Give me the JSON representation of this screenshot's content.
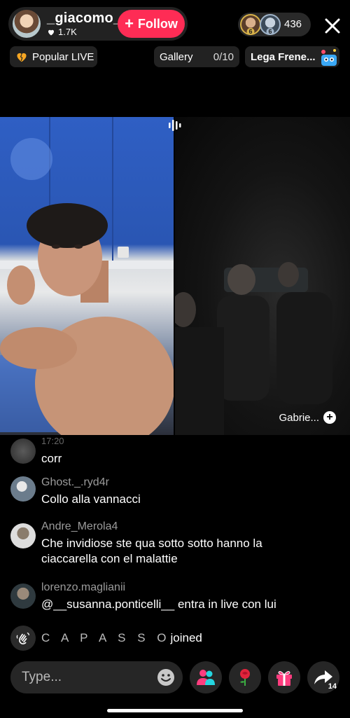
{
  "host": {
    "name": "_giacomo_",
    "likes": "1.7K",
    "follow_label": "Follow"
  },
  "viewers": {
    "badges": [
      "6",
      "6"
    ],
    "count": "436"
  },
  "pills": {
    "popular": "Popular LIVE",
    "gallery": "Gallery",
    "gallery_count": "0/10",
    "lega": "Lega Frene..."
  },
  "video": {
    "guest_label": "Gabrie..."
  },
  "comments": [
    {
      "user": "17:20",
      "text": "corr"
    },
    {
      "user": "Ghost._.ryd4r",
      "text": "Collo alla vannacci"
    },
    {
      "user": "Andre_Merola4",
      "text": "Che invidiose ste qua sotto sotto hanno la ciaccarella con el malattie"
    },
    {
      "user": "lorenzo.maglianii",
      "text": "@__susanna.ponticelli__ entra in live con lui"
    }
  ],
  "joined": {
    "name": "C A P A S S O",
    "label": "joined"
  },
  "bottom": {
    "placeholder": "Type...",
    "share_count": "14"
  },
  "colors": {
    "follow": "#fe2c55",
    "background": "#000000",
    "username": "#9b9b9b"
  }
}
